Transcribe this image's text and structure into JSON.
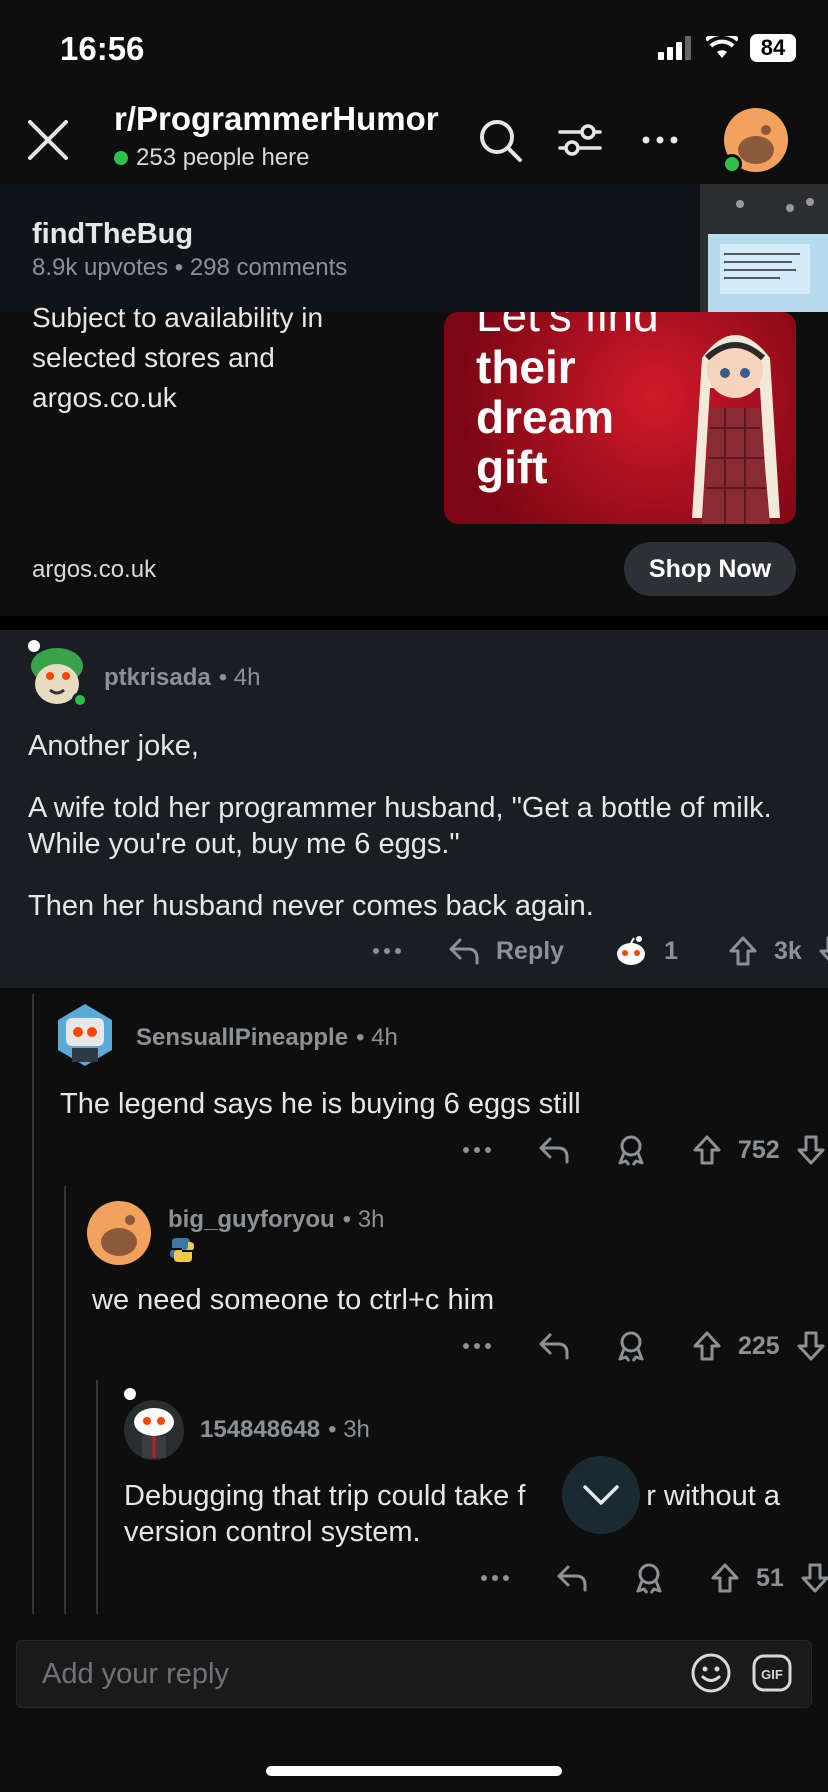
{
  "status_bar": {
    "time": "16:56",
    "battery": "84"
  },
  "header": {
    "subreddit": "r/ProgrammerHumor",
    "online": "253 people here"
  },
  "post": {
    "title": "findTheBug",
    "meta": "8.9k upvotes • 298 comments"
  },
  "ad": {
    "body_lines": [
      "Subject to availability in",
      "selected stores and",
      "argos.co.uk"
    ],
    "image_text": [
      "Let's find",
      "their",
      "dream",
      "gift"
    ],
    "domain": "argos.co.uk",
    "cta": "Shop Now"
  },
  "comments": [
    {
      "user": "ptkrisada",
      "time": "• 4h",
      "paragraphs": [
        "Another joke,",
        "A wife told her programmer husband, \"Get a bottle of milk. While you're out, buy me 6 eggs.\"",
        "Then her husband never comes back again."
      ],
      "reply_label": "Reply",
      "award_count": "1",
      "votes": "3k"
    },
    {
      "user": "SensuallPineapple",
      "time": "• 4h",
      "text": "The legend says he is buying 6 eggs still",
      "votes": "752"
    },
    {
      "user": "big_guyforyou",
      "time": "• 3h",
      "text": "we need someone to ctrl+c him",
      "votes": "225"
    },
    {
      "user": "154848648",
      "time": "• 3h",
      "text_line1_a": "Debugging that trip could take f",
      "text_line1_b": "r without a",
      "text_line2": "version control system.",
      "votes": "51"
    }
  ],
  "reply_box": {
    "placeholder": "Add your reply"
  },
  "colors": {
    "accent_online": "#2bc24a",
    "ad_red": "#c8102e",
    "avatar_orange": "#f2a25d"
  }
}
